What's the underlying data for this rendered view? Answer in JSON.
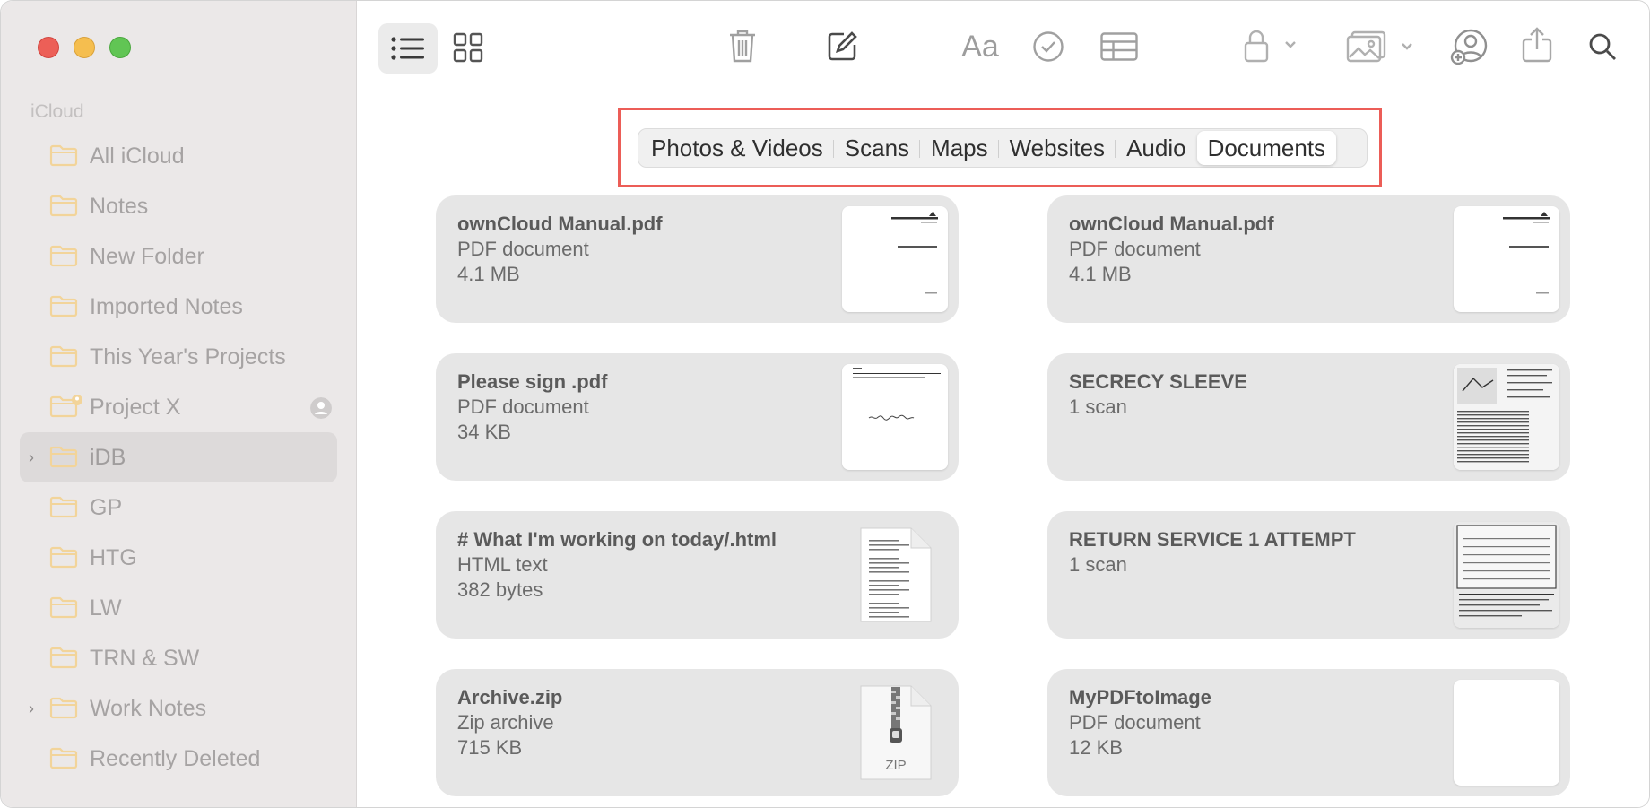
{
  "sidebar": {
    "section_label": "iCloud",
    "folders": [
      {
        "label": "All iCloud"
      },
      {
        "label": "Notes"
      },
      {
        "label": "New Folder"
      },
      {
        "label": "Imported Notes"
      },
      {
        "label": "This Year's Projects"
      },
      {
        "label": "Project X",
        "shared": true
      },
      {
        "label": "iDB",
        "selected": true,
        "expandable": true
      },
      {
        "label": "GP"
      },
      {
        "label": "HTG"
      },
      {
        "label": "LW"
      },
      {
        "label": "TRN & SW"
      },
      {
        "label": "Work Notes",
        "expandable": true
      },
      {
        "label": "Recently Deleted"
      }
    ]
  },
  "toolbar": {
    "icons": [
      "list-view-icon",
      "gallery-view-icon",
      "trash-icon",
      "compose-icon",
      "format-text-icon",
      "checklist-icon",
      "table-icon",
      "lock-icon",
      "media-icon",
      "collaborate-icon",
      "share-icon",
      "search-icon"
    ],
    "format_label": "Aa"
  },
  "attachment_tabs": [
    {
      "label": "Photos & Videos"
    },
    {
      "label": "Scans"
    },
    {
      "label": "Maps"
    },
    {
      "label": "Websites"
    },
    {
      "label": "Audio"
    },
    {
      "label": "Documents",
      "active": true
    }
  ],
  "attachments": [
    {
      "title": "ownCloud Manual.pdf",
      "kind": "PDF document",
      "size": "4.1 MB",
      "thumb": "pdf"
    },
    {
      "title": "ownCloud Manual.pdf",
      "kind": "PDF document",
      "size": "4.1 MB",
      "thumb": "pdf"
    },
    {
      "title": "Please sign .pdf",
      "kind": "PDF document",
      "size": "34 KB",
      "thumb": "sign"
    },
    {
      "title": "SECRECY SLEEVE",
      "kind": "1 scan",
      "size": "",
      "thumb": "scan"
    },
    {
      "title": "# What I'm working on today/.html",
      "kind": "HTML text",
      "size": "382 bytes",
      "thumb": "html"
    },
    {
      "title": "RETURN SERVICE 1 ATTEMPT",
      "kind": "1 scan",
      "size": "",
      "thumb": "scan2"
    },
    {
      "title": "Archive.zip",
      "kind": "Zip archive",
      "size": "715 KB",
      "thumb": "zip",
      "icon_label": "ZIP"
    },
    {
      "title": "MyPDFtoImage",
      "kind": "PDF document",
      "size": "12 KB",
      "thumb": "blank"
    }
  ],
  "colors": {
    "accent_red": "#ec5d57",
    "folder_yellow": "#f3d9a4",
    "sidebar_bg": "#ebe8e8"
  }
}
